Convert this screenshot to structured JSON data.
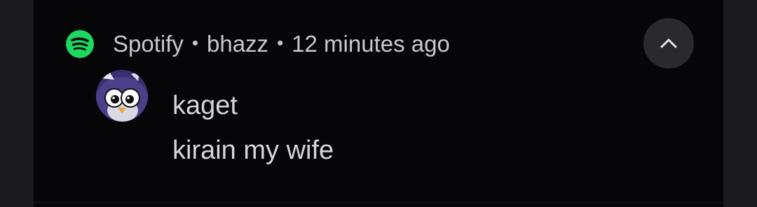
{
  "notification": {
    "app_icon": "spotify-icon",
    "app_name": "Spotify",
    "separator": "•",
    "conversation": "bhazz",
    "time": "12 minutes ago",
    "expand_icon": "chevron-up-icon",
    "message": {
      "avatar": "penguin-avatar",
      "sender": "kaget",
      "text": "kirain my wife"
    }
  },
  "colors": {
    "background": "#1b1b1d",
    "card": "#060608",
    "accent": "#1ed760",
    "text": "#d6d6d9",
    "header_text": "#c9c9cc",
    "button": "#2a2a2d"
  }
}
